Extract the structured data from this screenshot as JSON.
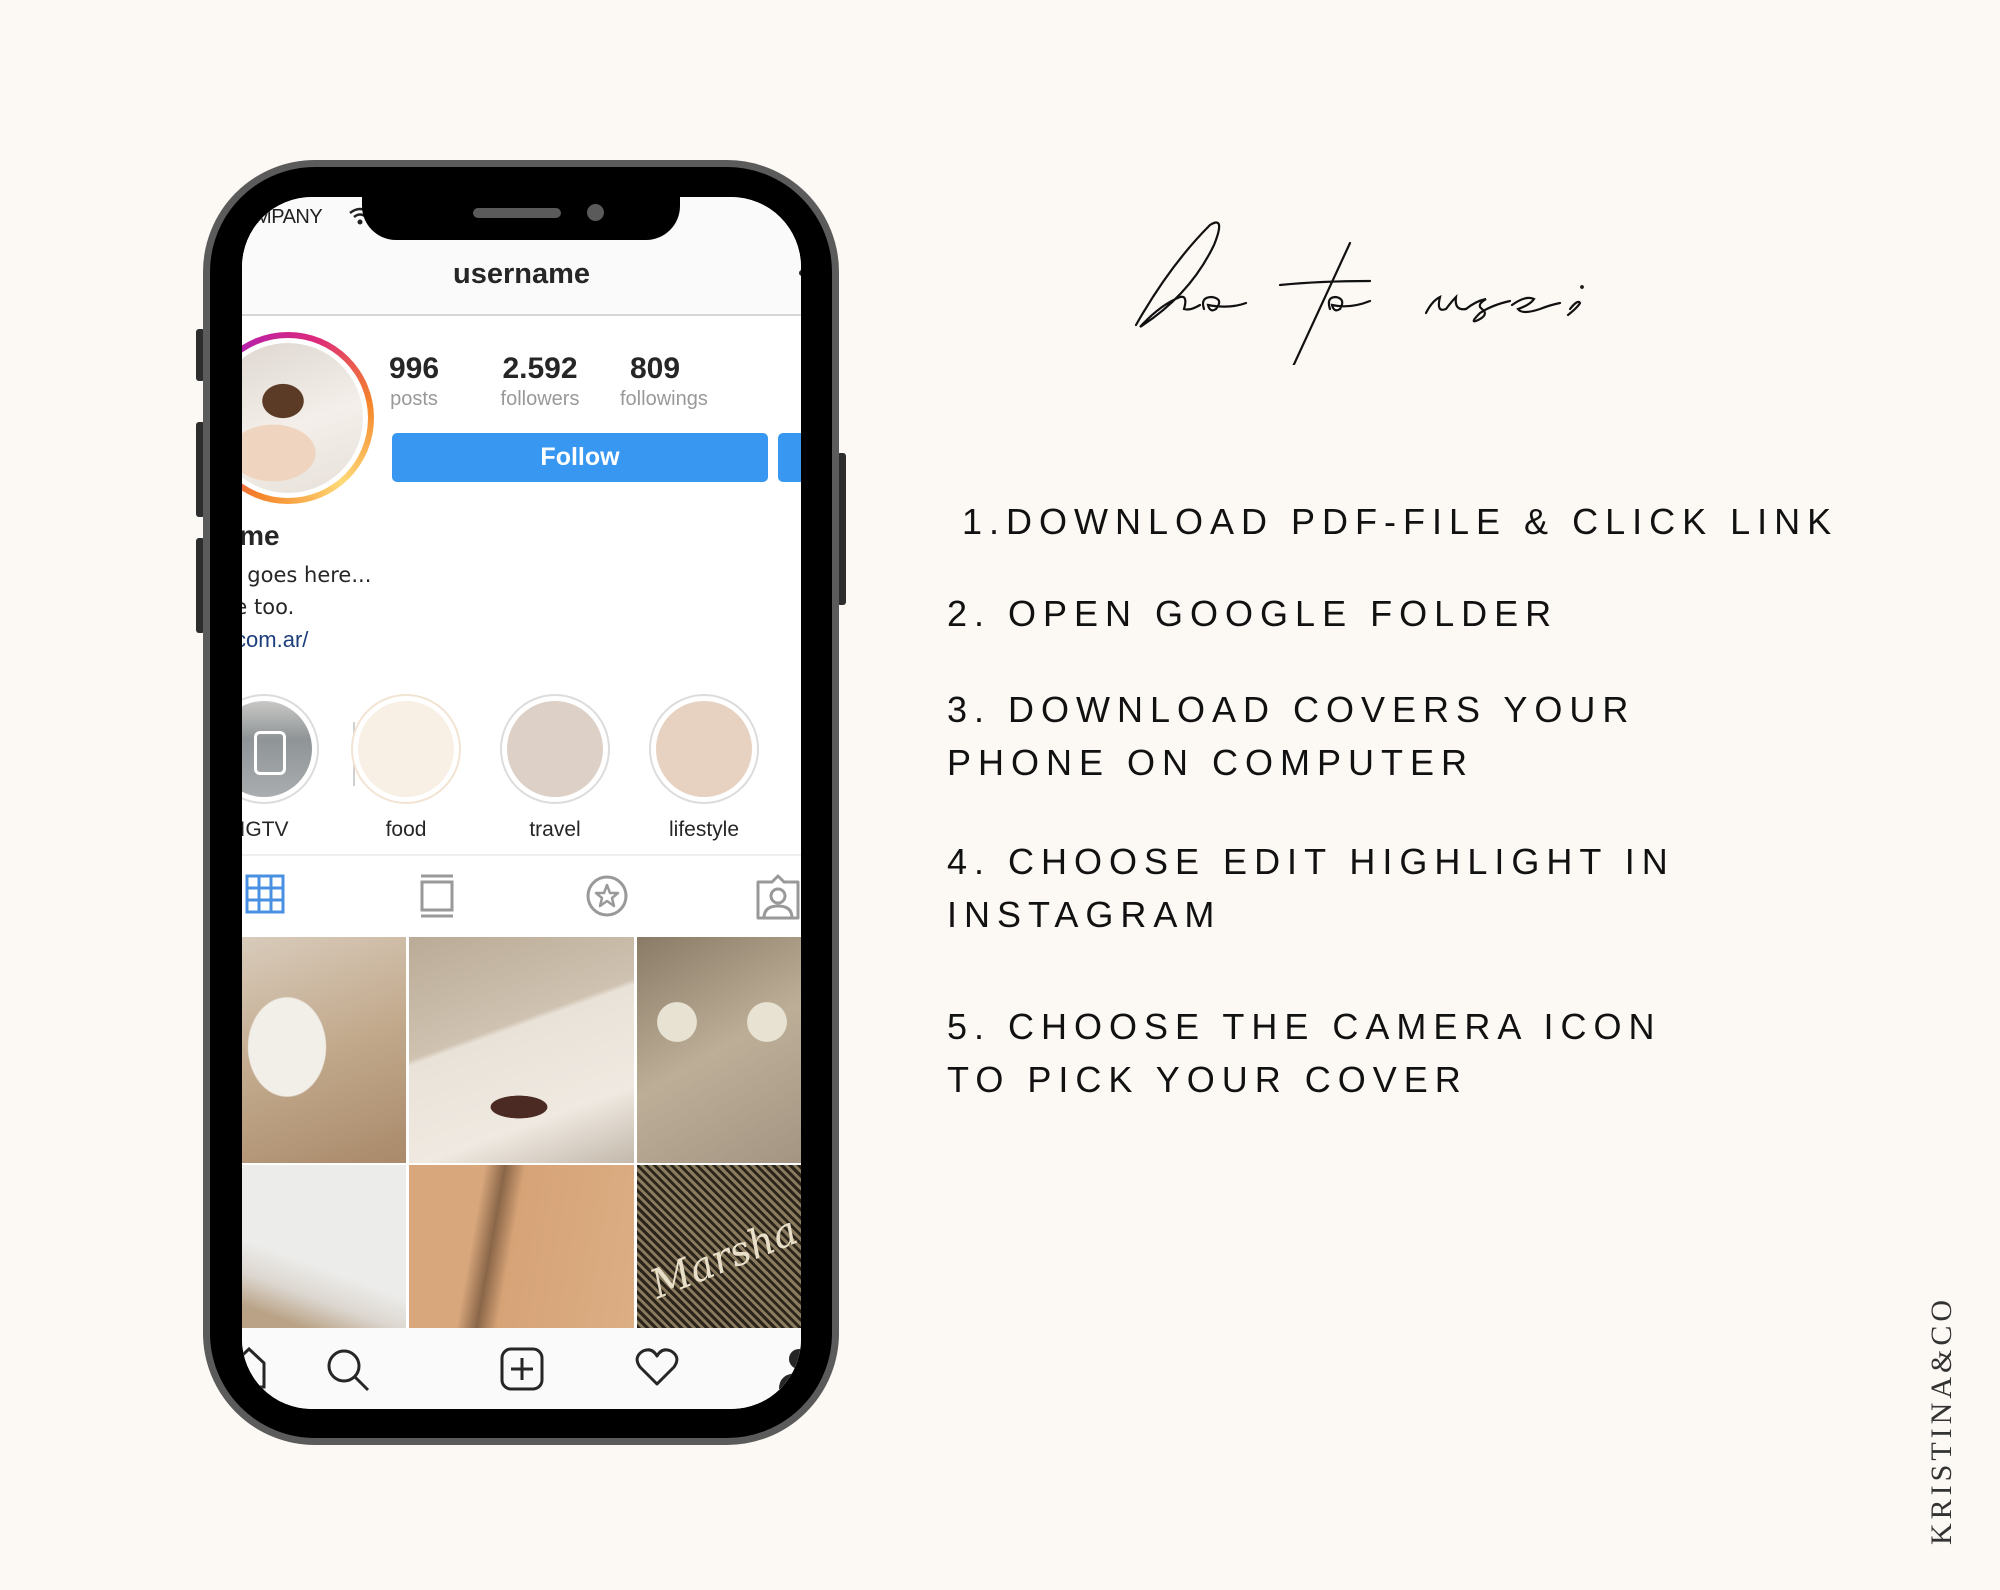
{
  "phone": {
    "status_bar": {
      "carrier": "OMPANY",
      "wifi_icon": "wifi-icon"
    },
    "top_bar": {
      "title": "username"
    },
    "profile": {
      "avatar_icon": "profile-photo",
      "stats": [
        {
          "value": "996",
          "label": "posts"
        },
        {
          "value": "2.592",
          "label": "followers"
        },
        {
          "value": "809",
          "label": "followings"
        }
      ],
      "follow_label": "Follow",
      "display_name": "ername",
      "bio_lines": [
        "ur bio goes here...",
        "d here too."
      ],
      "link": "rinad.com.ar/"
    },
    "highlights": [
      {
        "label": "IGTV",
        "color": "#9fa3a6"
      },
      {
        "label": "food",
        "color": "#f8efe5"
      },
      {
        "label": "travel",
        "color": "#ddd0c6"
      },
      {
        "label": "lifestyle",
        "color": "#e7d1c1"
      }
    ],
    "tabs": [
      {
        "icon": "grid-icon",
        "active": true
      },
      {
        "icon": "feed-icon",
        "active": false
      },
      {
        "icon": "star-icon",
        "active": false
      },
      {
        "icon": "tagged-icon",
        "active": false
      }
    ],
    "grid_posts": [
      {
        "subject": "white calla lily"
      },
      {
        "subject": "sunglasses on white surface"
      },
      {
        "subject": "glasses with star decorations"
      },
      {
        "subject": "sea foam"
      },
      {
        "subject": "sand with shadow"
      },
      {
        "subject": "Marshall speaker"
      }
    ],
    "bottom_nav": [
      "home-icon",
      "search-icon",
      "add-post-icon",
      "heart-icon",
      "profile-icon"
    ],
    "accent_color": "#3897f0"
  },
  "instructions": {
    "title": "ho to use;",
    "steps": [
      {
        "lines": [
          "1.DOWNLOAD PDF-FILE & CLICK LINK"
        ]
      },
      {
        "lines": [
          "2. OPEN GOOGLE FOLDER"
        ]
      },
      {
        "lines": [
          "3. DOWNLOAD COVERS YOUR",
          "PHONE ON COMPUTER"
        ]
      },
      {
        "lines": [
          "4. CHOOSE EDIT HIGHLIGHT IN",
          "INSTAGRAM"
        ]
      },
      {
        "lines": [
          "5. CHOOSE THE CAMERA ICON",
          "TO PICK YOUR COVER"
        ]
      }
    ]
  },
  "brand": "KRISTINA&CO",
  "colors": {
    "background": "#fcf8f4",
    "phone_frame": "#5b5b5b"
  }
}
